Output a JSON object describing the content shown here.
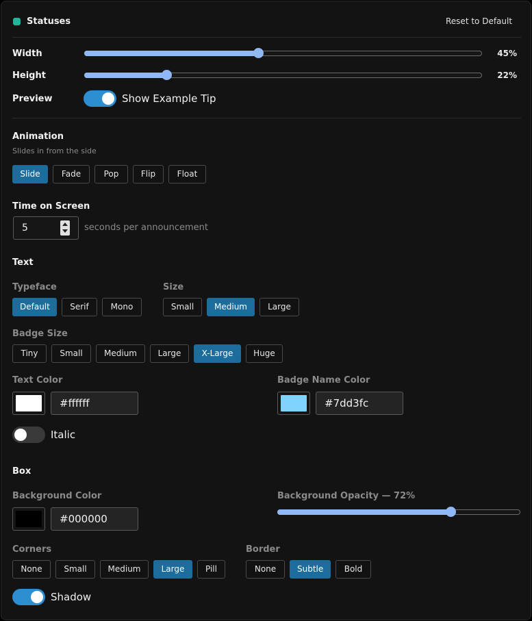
{
  "header": {
    "title": "Statuses",
    "reset_label": "Reset to Default",
    "accent": "#22b59a"
  },
  "dimensions": {
    "width": {
      "label": "Width",
      "value": 45,
      "display": "45%"
    },
    "height": {
      "label": "Height",
      "value": 22,
      "display": "22%"
    },
    "preview": {
      "label": "Preview",
      "toggle_label": "Show Example Tip",
      "on": true
    }
  },
  "animation": {
    "title": "Animation",
    "hint": "Slides in from the side",
    "options": [
      "Slide",
      "Fade",
      "Pop",
      "Flip",
      "Float"
    ],
    "selected": "Slide"
  },
  "time": {
    "title": "Time on Screen",
    "value": "5",
    "suffix": "seconds per announcement"
  },
  "text": {
    "title": "Text",
    "typeface": {
      "label": "Typeface",
      "options": [
        "Default",
        "Serif",
        "Mono"
      ],
      "selected": "Default"
    },
    "size": {
      "label": "Size",
      "options": [
        "Small",
        "Medium",
        "Large"
      ],
      "selected": "Medium"
    },
    "badge_size": {
      "label": "Badge Size",
      "options": [
        "Tiny",
        "Small",
        "Medium",
        "Large",
        "X-Large",
        "Huge"
      ],
      "selected": "X-Large"
    },
    "text_color": {
      "label": "Text Color",
      "value": "#ffffff"
    },
    "badge_name_color": {
      "label": "Badge Name Color",
      "value": "#7dd3fc"
    },
    "italic": {
      "label": "Italic",
      "on": false
    }
  },
  "box": {
    "title": "Box",
    "background_color": {
      "label": "Background Color",
      "value": "#000000"
    },
    "opacity": {
      "label": "Background Opacity — 72%",
      "value": 72
    },
    "corners": {
      "label": "Corners",
      "options": [
        "None",
        "Small",
        "Medium",
        "Large",
        "Pill"
      ],
      "selected": "Large"
    },
    "border": {
      "label": "Border",
      "options": [
        "None",
        "Subtle",
        "Bold"
      ],
      "selected": "Subtle"
    },
    "shadow": {
      "label": "Shadow",
      "on": true
    }
  },
  "colors": {
    "accent_blue": "#1d6d9c",
    "slider": "#8fb8f5",
    "toggle_on": "#2d8fd2"
  }
}
